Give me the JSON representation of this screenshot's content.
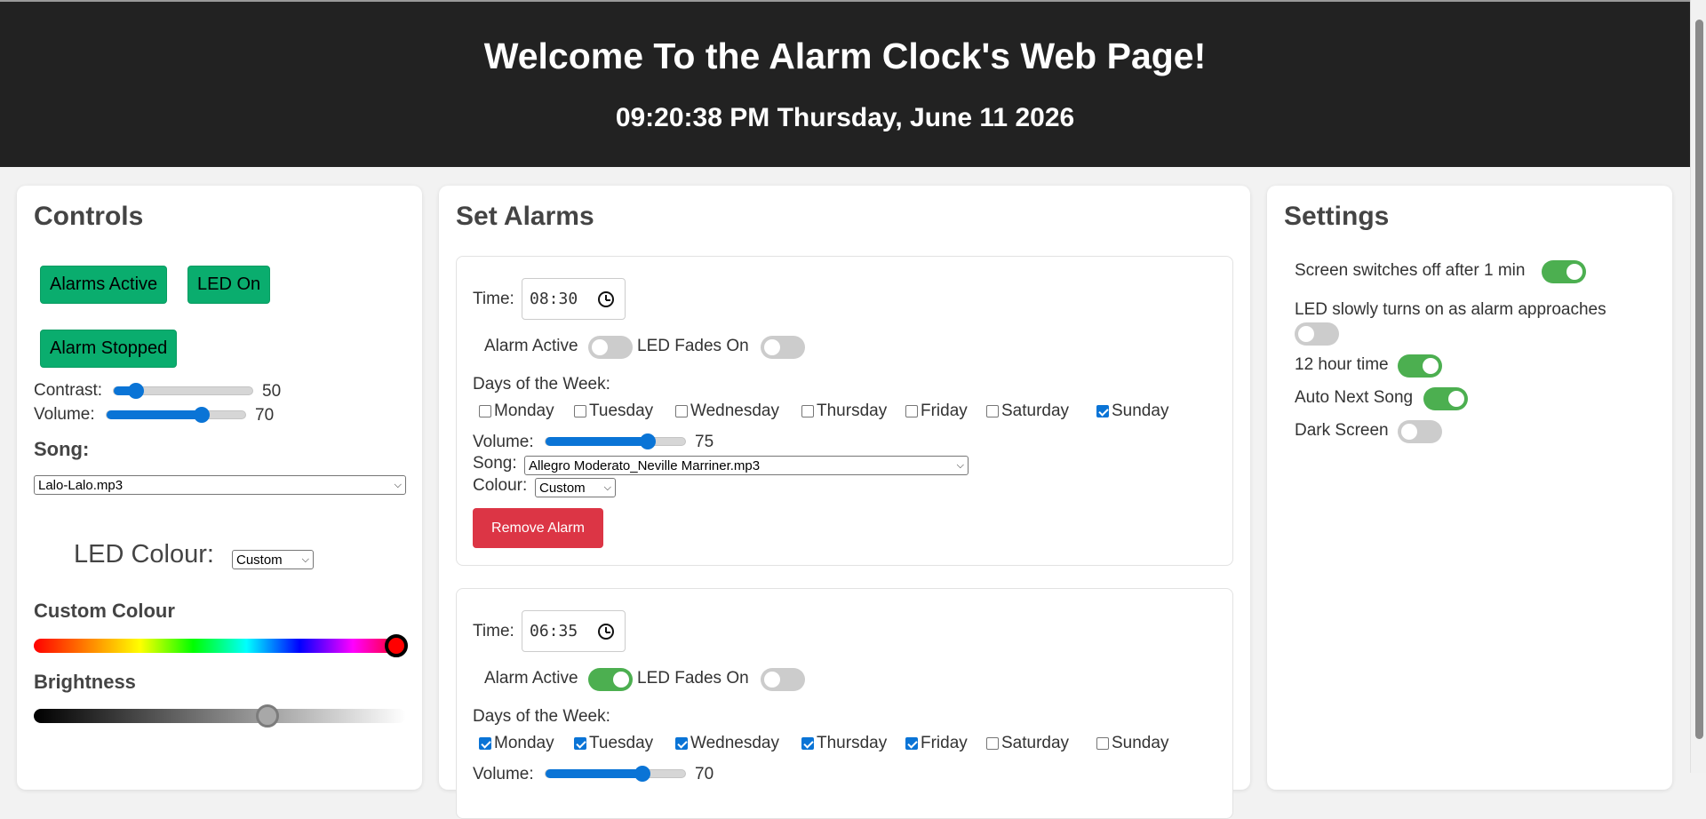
{
  "header": {
    "title": "Welcome To the Alarm Clock's Web Page!",
    "datetime": "09:20:38 PM Thursday, June 11 2026"
  },
  "controls": {
    "title": "Controls",
    "alarms_active_button": "Alarms Active",
    "led_on_button": "LED On",
    "alarm_stopped_button": "Alarm Stopped",
    "contrast_label": "Contrast:",
    "contrast_value": "50",
    "volume_label": "Volume:",
    "volume_value": "70",
    "song_label": "Song:",
    "song_value": "Lalo-Lalo.mp3",
    "led_colour_label": "LED Colour:",
    "led_colour_value": "Custom",
    "custom_colour_label": "Custom Colour",
    "brightness_label": "Brightness"
  },
  "alarms": {
    "title": "Set Alarms",
    "time_label": "Time:",
    "alarm_active_label": "Alarm Active",
    "led_fades_label": "LED Fades On",
    "days_label": "Days of the Week:",
    "days": [
      "Monday",
      "Tuesday",
      "Wednesday",
      "Thursday",
      "Friday",
      "Saturday",
      "Sunday"
    ],
    "volume_label": "Volume:",
    "song_label": "Song:",
    "colour_label": "Colour:",
    "remove_label": "Remove Alarm",
    "items": [
      {
        "time": "08:30",
        "alarm_active": false,
        "led_fades": false,
        "days_checked": [
          false,
          false,
          false,
          false,
          false,
          false,
          true
        ],
        "volume": "75",
        "song": "Allegro Moderato_Neville Marriner.mp3",
        "colour": "Custom"
      },
      {
        "time": "06:35",
        "alarm_active": true,
        "led_fades": false,
        "days_checked": [
          true,
          true,
          true,
          true,
          true,
          false,
          false
        ],
        "volume": "70"
      }
    ]
  },
  "settings": {
    "title": "Settings",
    "items": [
      {
        "label": "Screen switches off after 1 min",
        "on": true
      },
      {
        "label": "LED slowly turns on as alarm approaches",
        "on": false
      },
      {
        "label": "12 hour time",
        "on": true
      },
      {
        "label": "Auto Next Song",
        "on": true
      },
      {
        "label": "Dark Screen",
        "on": false
      }
    ]
  },
  "colors": {
    "header_bg": "#222222",
    "button_green": "#0aad6e",
    "toggle_on": "#4caf50",
    "remove_red": "#dc3545",
    "slider_blue": "#0a74d6"
  }
}
